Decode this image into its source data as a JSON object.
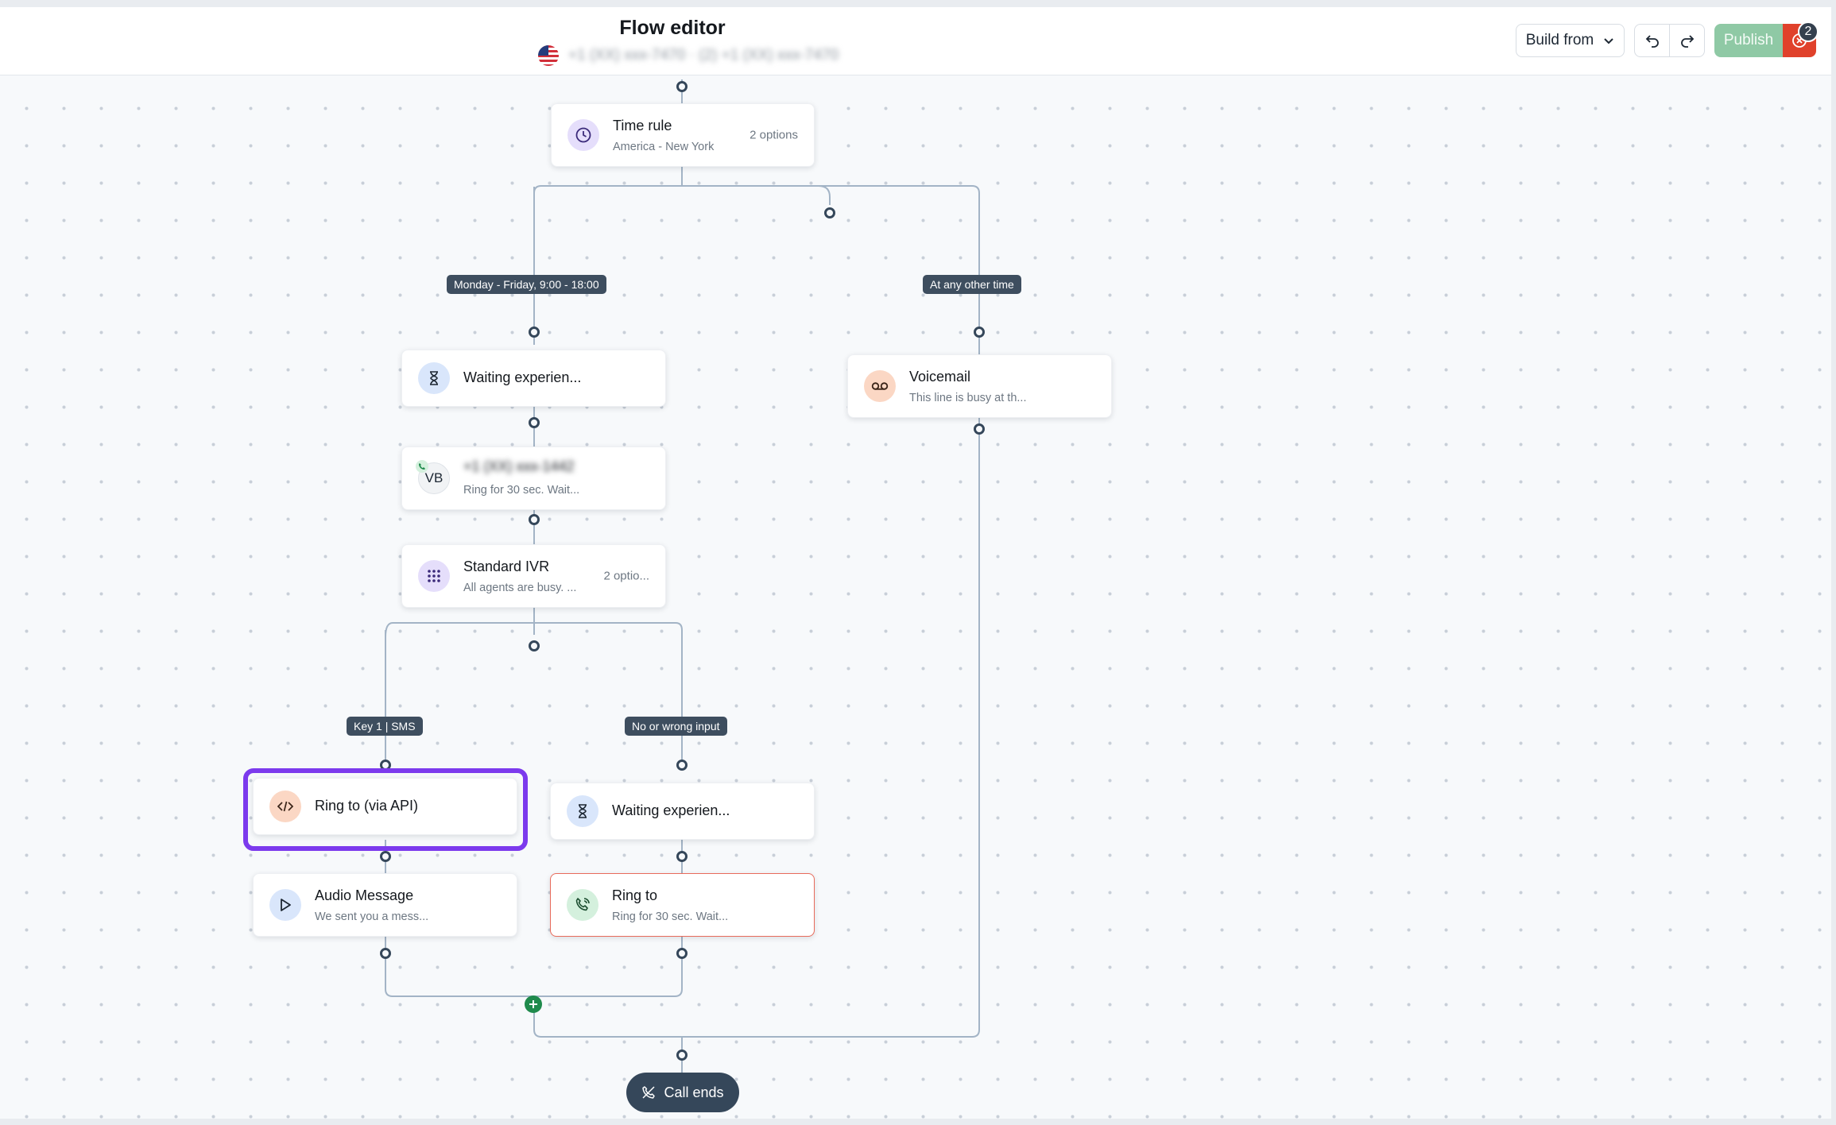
{
  "header": {
    "title": "Flow editor",
    "subtitle_blurred": "+1 (XX) xxx-7470  ·  (2) +1 (XX) xxx-7470",
    "build_from_label": "Build from",
    "publish_label": "Publish",
    "error_count": "2"
  },
  "nodes": {
    "time_rule": {
      "title": "Time rule",
      "subtitle": "America - New York",
      "right": "2 options"
    },
    "waiting_1": {
      "title": "Waiting experien..."
    },
    "ring_vb": {
      "avatar": "VB",
      "title_blurred": "+1 (XX) xxx-1442",
      "subtitle": "Ring for 30 sec. Wait..."
    },
    "standard_ivr": {
      "title": "Standard IVR",
      "subtitle": "All agents are busy. ...",
      "right": "2 optio..."
    },
    "voicemail": {
      "title": "Voicemail",
      "subtitle": "This line is busy at th..."
    },
    "ring_api": {
      "title": "Ring to (via API)"
    },
    "waiting_2": {
      "title": "Waiting experien..."
    },
    "audio_message": {
      "title": "Audio Message",
      "subtitle": "We sent you a mess..."
    },
    "ring_to": {
      "title": "Ring to",
      "subtitle": "Ring for 30 sec. Wait..."
    }
  },
  "branches": {
    "weekday": "Monday - Friday, 9:00 - 18:00",
    "other_time": "At any other time",
    "key1": "Key 1 | SMS",
    "no_input": "No or wrong input"
  },
  "end": {
    "label": "Call ends"
  },
  "colors": {
    "accent_selection": "#7c3aed",
    "publish_disabled": "#8fc9a5",
    "error_red": "#e0412b",
    "connector": "#9fb3c8",
    "pill": "#3e4e5f",
    "add_green": "#1f8a4c"
  }
}
